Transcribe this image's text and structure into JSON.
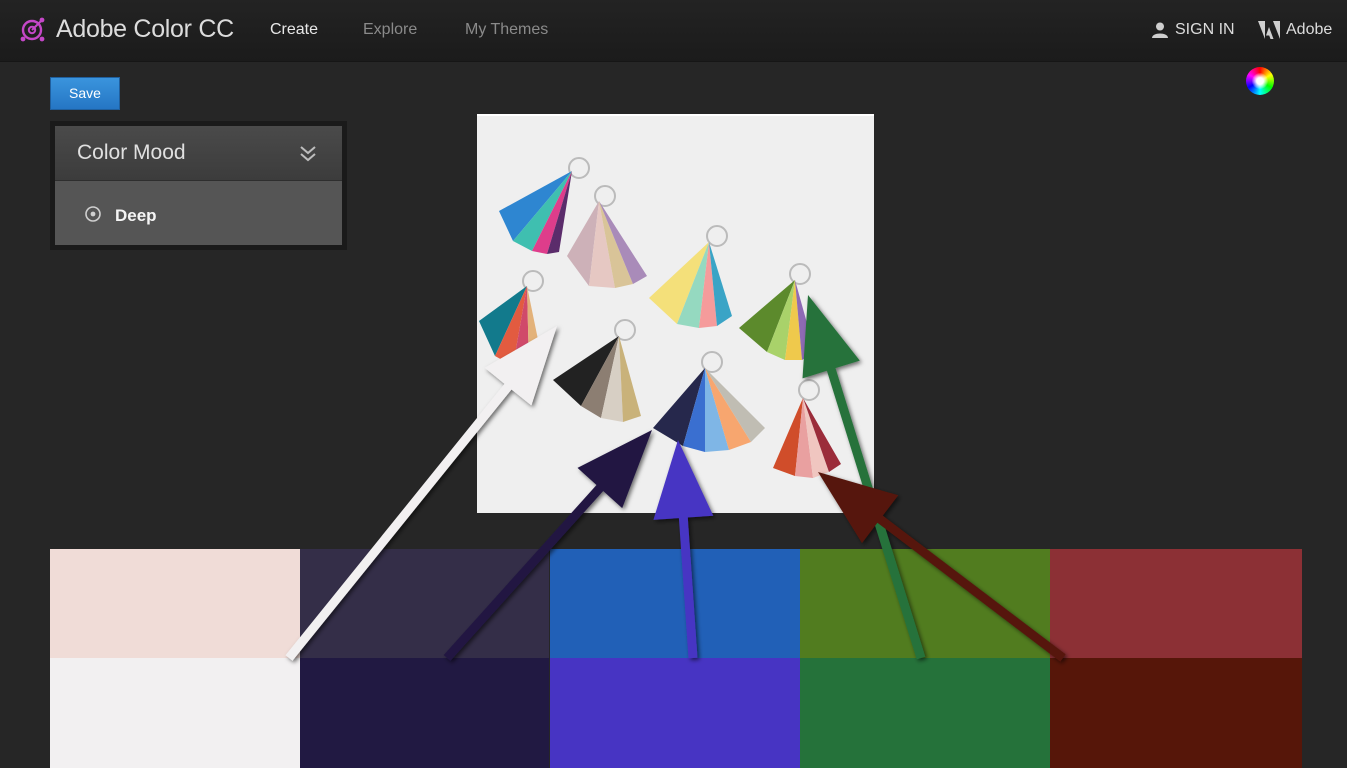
{
  "app": {
    "title": "Adobe Color CC"
  },
  "nav": [
    {
      "label": "Create",
      "active": true
    },
    {
      "label": "Explore",
      "active": false
    },
    {
      "label": "My Themes",
      "active": false
    }
  ],
  "account": {
    "sign_in_label": "SIGN IN",
    "sign_in_icon": "user-icon",
    "brand_label": "Adobe",
    "brand_icon": "adobe-logo-icon"
  },
  "toolbar": {
    "save_label": "Save",
    "color_wheel_icon": "color-wheel-icon"
  },
  "mood_panel": {
    "title": "Color Mood",
    "toggle_icon": "double-chevron-down-icon",
    "selected_option": "Deep",
    "option_icon": "radio-selected-icon"
  },
  "source_image": {
    "content": "pantone-fan-decks-photo"
  },
  "palette": {
    "top_row": [
      "#F0DCD7",
      "#342E48",
      "#2160B7",
      "#517C1F",
      "#8C3035"
    ],
    "bottom_row": [
      "#F2F0F1",
      "#211942",
      "#4734C3",
      "#25723A",
      "#561609"
    ]
  },
  "annotation_arrows": {
    "colors": [
      "#F2F0F1",
      "#211942",
      "#4734C3",
      "#25723A",
      "#561609"
    ]
  }
}
